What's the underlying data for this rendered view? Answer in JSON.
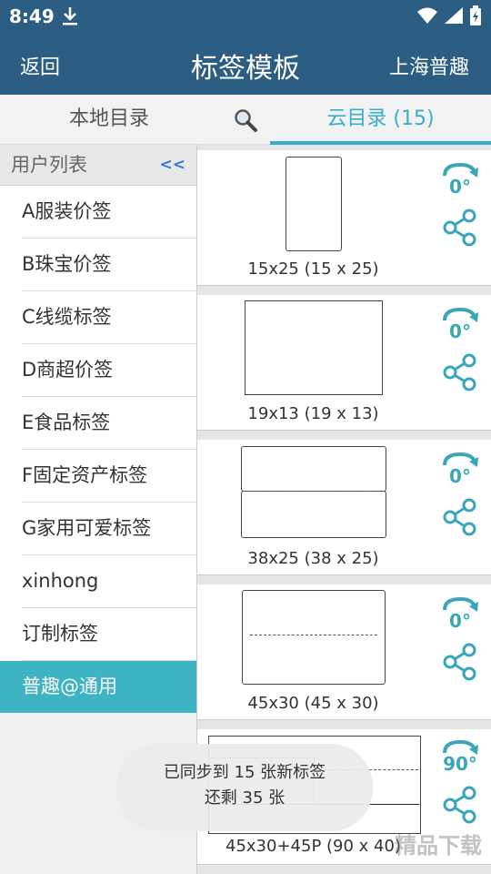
{
  "status_bar": {
    "time": "8:49"
  },
  "header": {
    "back_label": "返回",
    "title": "标签模板",
    "brand_label": "上海普趣"
  },
  "tabs": {
    "local": "本地目录",
    "cloud": "云目录 (15)"
  },
  "sidebar": {
    "header": "用户列表",
    "collapse": "<<",
    "items": [
      {
        "label": "A服装价签"
      },
      {
        "label": "B珠宝价签"
      },
      {
        "label": "C线缆标签"
      },
      {
        "label": "D商超价签"
      },
      {
        "label": "E食品标签"
      },
      {
        "label": "F固定资产标签"
      },
      {
        "label": "G家用可爱标签"
      },
      {
        "label": "xinhong"
      },
      {
        "label": "订制标签"
      },
      {
        "label": "普趣@通用",
        "active": true
      }
    ]
  },
  "templates": [
    {
      "size": "15x25 (15 x 25)",
      "rotation": "0°"
    },
    {
      "size": "19x13 (19 x 13)",
      "rotation": "0°"
    },
    {
      "size": "38x25 (38 x 25)",
      "rotation": "0°"
    },
    {
      "size": "45x30 (45 x 30)",
      "rotation": "0°"
    },
    {
      "size": "45x30+45P (90 x 40)",
      "rotation": "90°"
    }
  ],
  "toast": {
    "line1": "已同步到 15 张新标签",
    "line2": "还剩 35 张"
  },
  "watermark": "精品下载",
  "colors": {
    "header": "#2b5e82",
    "accent": "#3aaec9",
    "active_item": "#3db3c4"
  },
  "icons": [
    "download-icon",
    "wifi-icon",
    "signal-icon",
    "battery-icon",
    "search-icon",
    "rotate-icon",
    "share-icon"
  ]
}
